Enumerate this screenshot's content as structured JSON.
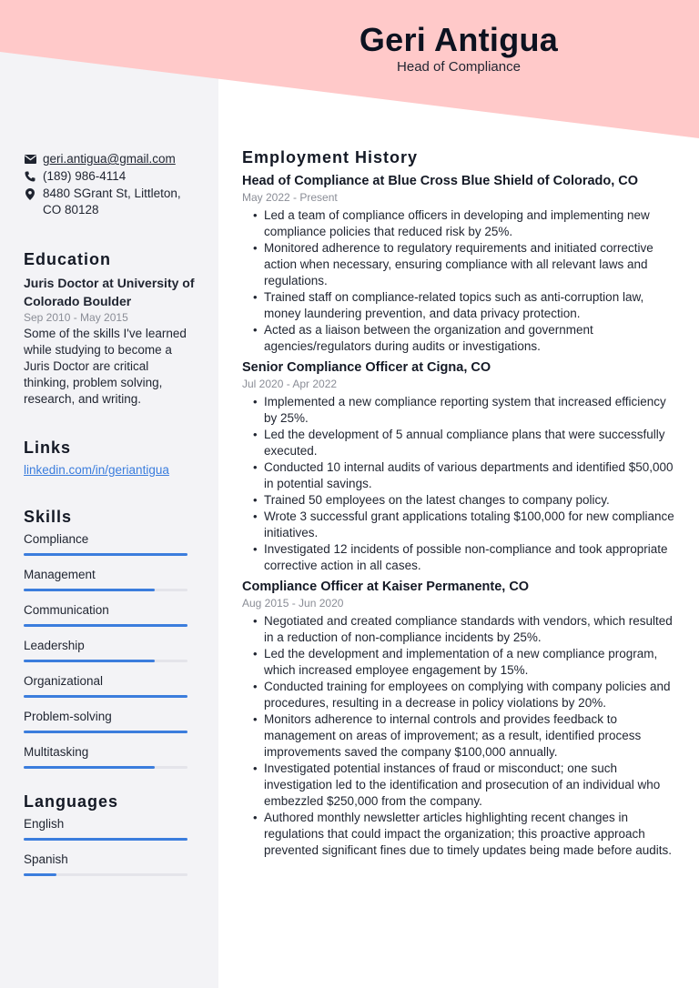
{
  "header": {
    "name": "Geri Antigua",
    "role": "Head of Compliance"
  },
  "colors": {
    "banner": "#ffc9c9",
    "sidebar": "#f3f3f6",
    "accent": "#3b7ddd",
    "bar_track": "#e4e4ea"
  },
  "contact": {
    "email": "geri.antigua@gmail.com",
    "phone": "(189) 986-4114",
    "address": "8480 SGrant St, Littleton, CO 80128",
    "icons": [
      "envelope-icon",
      "phone-icon",
      "map-pin-icon"
    ]
  },
  "education": {
    "title": "Education",
    "items": [
      {
        "degree": "Juris Doctor at University of Colorado Boulder",
        "dates": "Sep 2010 - May 2015",
        "description": "Some of the skills I've learned while studying to become a Juris Doctor are critical thinking, problem solving, research, and writing."
      }
    ]
  },
  "links": {
    "title": "Links",
    "items": [
      {
        "label": "linkedin.com/in/geriantigua"
      }
    ]
  },
  "skills": {
    "title": "Skills",
    "items": [
      {
        "label": "Compliance",
        "level": 1.0
      },
      {
        "label": "Management",
        "level": 0.8
      },
      {
        "label": "Communication",
        "level": 1.0
      },
      {
        "label": "Leadership",
        "level": 0.8
      },
      {
        "label": "Organizational",
        "level": 1.0
      },
      {
        "label": "Problem-solving",
        "level": 1.0
      },
      {
        "label": "Multitasking",
        "level": 0.8
      }
    ]
  },
  "languages": {
    "title": "Languages",
    "items": [
      {
        "label": "English",
        "level": 1.0
      },
      {
        "label": "Spanish",
        "level": 0.2
      }
    ]
  },
  "employment": {
    "title": "Employment History",
    "jobs": [
      {
        "title": "Head of Compliance at Blue Cross Blue Shield of Colorado, CO",
        "dates": "May 2022 - Present",
        "bullets": [
          "Led a team of compliance officers in developing and implementing new compliance policies that reduced risk by 25%.",
          "Monitored adherence to regulatory requirements and initiated corrective action when necessary, ensuring compliance with all relevant laws and regulations.",
          "Trained staff on compliance-related topics such as anti-corruption law, money laundering prevention, and data privacy protection.",
          "Acted as a liaison between the organization and government agencies/regulators during audits or investigations."
        ]
      },
      {
        "title": "Senior Compliance Officer at Cigna, CO",
        "dates": "Jul 2020 - Apr 2022",
        "bullets": [
          "Implemented a new compliance reporting system that increased efficiency by 25%.",
          "Led the development of 5 annual compliance plans that were successfully executed.",
          "Conducted 10 internal audits of various departments and identified $50,000 in potential savings.",
          "Trained 50 employees on the latest changes to company policy.",
          "Wrote 3 successful grant applications totaling $100,000 for new compliance initiatives.",
          "Investigated 12 incidents of possible non-compliance and took appropriate corrective action in all cases."
        ]
      },
      {
        "title": "Compliance Officer at Kaiser Permanente, CO",
        "dates": "Aug 2015 - Jun 2020",
        "bullets": [
          "Negotiated and created compliance standards with vendors, which resulted in a reduction of non-compliance incidents by 25%.",
          "Led the development and implementation of a new compliance program, which increased employee engagement by 15%.",
          "Conducted training for employees on complying with company policies and procedures, resulting in a decrease in policy violations by 20%.",
          "Monitors adherence to internal controls and provides feedback to management on areas of improvement; as a result, identified process improvements saved the company $100,000 annually.",
          "Investigated potential instances of fraud or misconduct; one such investigation led to the identification and prosecution of an individual who embezzled $250,000 from the company.",
          "Authored monthly newsletter articles highlighting recent changes in regulations that could impact the organization; this proactive approach prevented significant fines due to timely updates being made before audits."
        ]
      }
    ]
  }
}
